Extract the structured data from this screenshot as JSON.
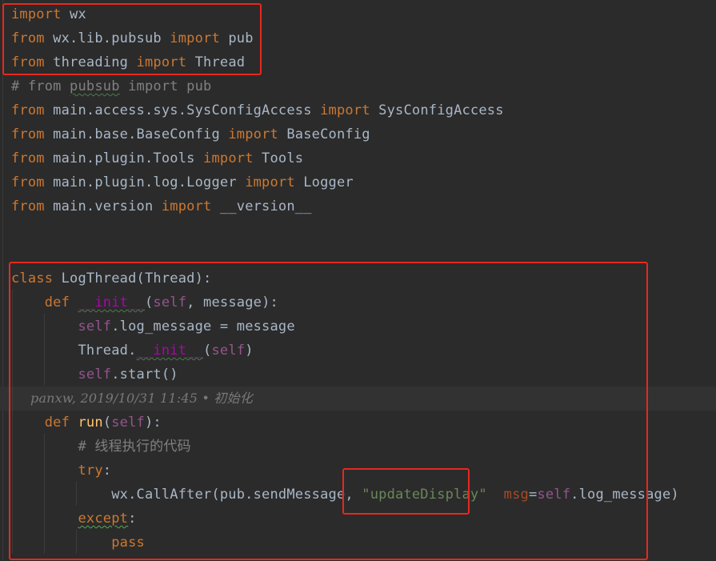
{
  "colors": {
    "background": "#2b2b2b",
    "keyword": "#cc7832",
    "text": "#a9b7c6",
    "self": "#94558d",
    "dunder": "#b200b2",
    "function": "#ffc66d",
    "comment": "#808080",
    "string": "#6a8759",
    "param": "#aa4926",
    "highlight": "#e8281e"
  },
  "lines": [
    {
      "tokens": [
        {
          "t": "import",
          "c": "kw"
        },
        {
          "t": " wx",
          "c": "txt"
        }
      ]
    },
    {
      "tokens": [
        {
          "t": "from",
          "c": "kw"
        },
        {
          "t": " wx.lib.pubsub ",
          "c": "txt"
        },
        {
          "t": "import",
          "c": "kw"
        },
        {
          "t": " pub",
          "c": "txt"
        }
      ]
    },
    {
      "tokens": [
        {
          "t": "from",
          "c": "kw"
        },
        {
          "t": " threading ",
          "c": "txt"
        },
        {
          "t": "import",
          "c": "kw"
        },
        {
          "t": " Thread",
          "c": "txt"
        }
      ]
    },
    {
      "tokens": [
        {
          "t": "# from ",
          "c": "comment"
        },
        {
          "t": "pubsub",
          "c": "comment",
          "u": "wavy-dim"
        },
        {
          "t": " import pub",
          "c": "comment"
        }
      ]
    },
    {
      "tokens": [
        {
          "t": "from",
          "c": "kw"
        },
        {
          "t": " main.access.sys.SysConfigAccess ",
          "c": "txt"
        },
        {
          "t": "import",
          "c": "kw"
        },
        {
          "t": " SysConfigAccess",
          "c": "txt"
        }
      ]
    },
    {
      "tokens": [
        {
          "t": "from",
          "c": "kw"
        },
        {
          "t": " main.base.BaseConfig ",
          "c": "txt"
        },
        {
          "t": "import",
          "c": "kw"
        },
        {
          "t": " BaseConfig",
          "c": "txt"
        }
      ]
    },
    {
      "tokens": [
        {
          "t": "from",
          "c": "kw"
        },
        {
          "t": " main.plugin.Tools ",
          "c": "txt"
        },
        {
          "t": "import",
          "c": "kw"
        },
        {
          "t": " Tools",
          "c": "txt"
        }
      ]
    },
    {
      "tokens": [
        {
          "t": "from",
          "c": "kw"
        },
        {
          "t": " main.plugin.log.Logger ",
          "c": "txt"
        },
        {
          "t": "import",
          "c": "kw"
        },
        {
          "t": " Logger",
          "c": "txt"
        }
      ]
    },
    {
      "tokens": [
        {
          "t": "from",
          "c": "kw"
        },
        {
          "t": " main.version ",
          "c": "txt"
        },
        {
          "t": "import",
          "c": "kw"
        },
        {
          "t": " __version__",
          "c": "txt"
        }
      ]
    },
    {
      "tokens": []
    },
    {
      "tokens": []
    },
    {
      "tokens": [
        {
          "t": "class",
          "c": "kw"
        },
        {
          "t": " LogThread(Thread):",
          "c": "txt"
        }
      ]
    },
    {
      "tokens": [
        {
          "t": "    ",
          "c": "txt"
        },
        {
          "t": "def",
          "c": "kw"
        },
        {
          "t": " ",
          "c": "txt"
        },
        {
          "t": "__init__",
          "c": "dunder",
          "u": "wavy-dim"
        },
        {
          "t": "(",
          "c": "txt"
        },
        {
          "t": "self",
          "c": "self"
        },
        {
          "t": ", message):",
          "c": "txt"
        }
      ]
    },
    {
      "tokens": [
        {
          "t": "        ",
          "c": "txt"
        },
        {
          "t": "self",
          "c": "self"
        },
        {
          "t": ".log_message = message",
          "c": "txt"
        }
      ]
    },
    {
      "tokens": [
        {
          "t": "        Thread.",
          "c": "txt"
        },
        {
          "t": "__init__",
          "c": "dunder",
          "u": "wavy-dim"
        },
        {
          "t": "(",
          "c": "txt"
        },
        {
          "t": "self",
          "c": "self"
        },
        {
          "t": ")",
          "c": "txt"
        }
      ]
    },
    {
      "tokens": [
        {
          "t": "        ",
          "c": "txt"
        },
        {
          "t": "self",
          "c": "self"
        },
        {
          "t": ".start()",
          "c": "txt"
        }
      ]
    },
    {
      "blame": "panxw, 2019/10/31 11:45 • 初始化"
    },
    {
      "tokens": [
        {
          "t": "    ",
          "c": "txt"
        },
        {
          "t": "def",
          "c": "kw"
        },
        {
          "t": " ",
          "c": "txt"
        },
        {
          "t": "run",
          "c": "fn"
        },
        {
          "t": "(",
          "c": "txt"
        },
        {
          "t": "self",
          "c": "self"
        },
        {
          "t": "):",
          "c": "txt"
        }
      ]
    },
    {
      "tokens": [
        {
          "t": "        # 线程执行的代码",
          "c": "comment"
        }
      ]
    },
    {
      "tokens": [
        {
          "t": "        ",
          "c": "txt"
        },
        {
          "t": "try",
          "c": "kw"
        },
        {
          "t": ":",
          "c": "txt"
        }
      ]
    },
    {
      "tokens": [
        {
          "t": "            wx.CallAfter(pub.sendMessage, ",
          "c": "txt"
        },
        {
          "t": "\"updateDisplay\"",
          "c": "str"
        },
        {
          "t": "  ",
          "c": "txt"
        },
        {
          "t": "msg",
          "c": "param"
        },
        {
          "t": "=",
          "c": "txt"
        },
        {
          "t": "self",
          "c": "self"
        },
        {
          "t": ".log_message)",
          "c": "txt"
        }
      ]
    },
    {
      "tokens": [
        {
          "t": "        ",
          "c": "txt"
        },
        {
          "t": "except",
          "c": "kw",
          "u": "wavy"
        },
        {
          "t": ":",
          "c": "txt"
        }
      ]
    },
    {
      "tokens": [
        {
          "t": "            ",
          "c": "txt"
        },
        {
          "t": "pass",
          "c": "kw"
        }
      ]
    }
  ]
}
